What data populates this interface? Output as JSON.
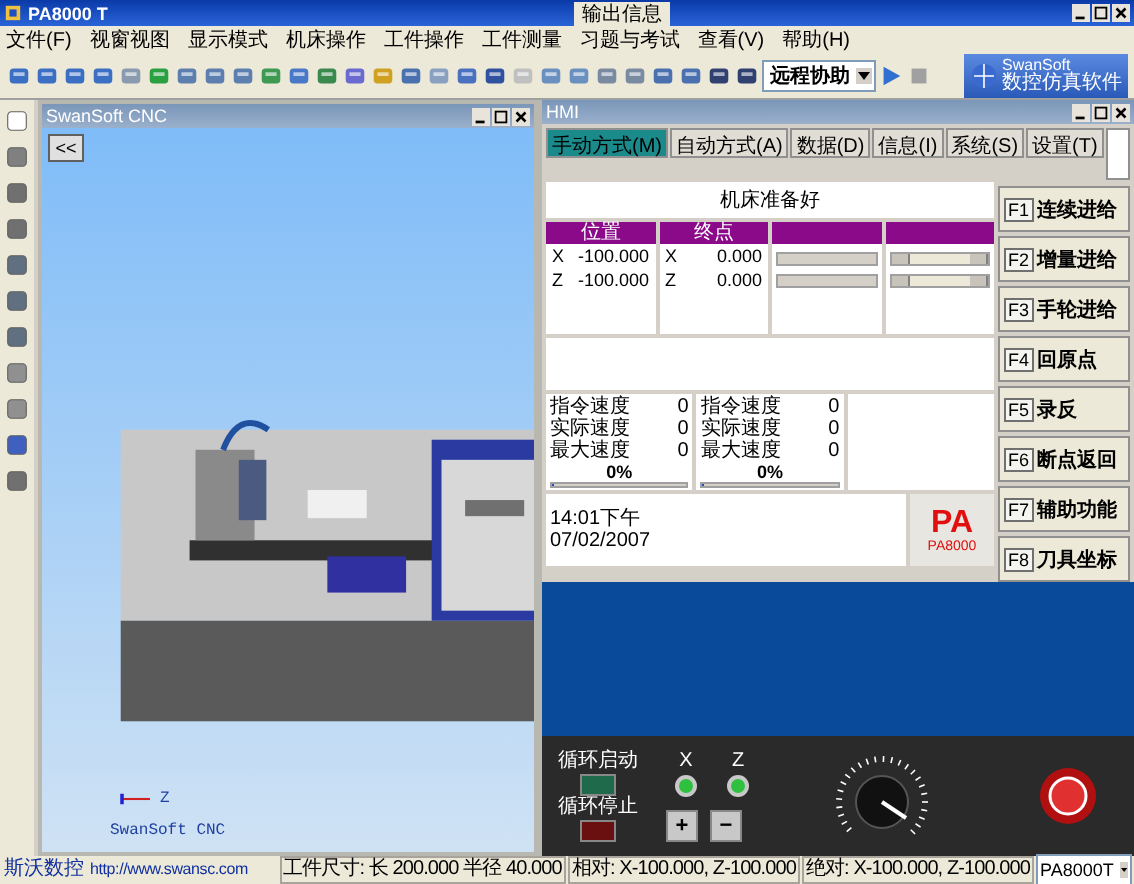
{
  "window": {
    "title": "PA8000 T",
    "output_tab": "输出信息"
  },
  "menu": [
    "文件(F)",
    "视窗视图",
    "显示模式",
    "机床操作",
    "工件操作",
    "工件测量",
    "习题与考试",
    "查看(V)",
    "帮助(H)"
  ],
  "toolbar": {
    "dropdown": "远程协助",
    "logo_line1": "SwanSoft",
    "logo_line2": "数控仿真软件"
  },
  "sim_window": {
    "title": "SwanSoft CNC",
    "collapse": "<<",
    "axis_label": "Z",
    "caption": "SwanSoft CNC"
  },
  "hmi": {
    "title": "HMI",
    "tabs": [
      {
        "label": "手动方式(M)",
        "selected": true
      },
      {
        "label": "自动方式(A)",
        "selected": false
      },
      {
        "label": "数据(D)",
        "selected": false
      },
      {
        "label": "信息(I)",
        "selected": false
      },
      {
        "label": "系统(S)",
        "selected": false
      },
      {
        "label": "设置(T)",
        "selected": false
      }
    ],
    "message": "机床准备好",
    "tables": [
      {
        "heading": "位置",
        "rows": [
          {
            "axis": "X",
            "value": "-100.000"
          },
          {
            "axis": "Z",
            "value": "-100.000"
          }
        ]
      },
      {
        "heading": "终点",
        "rows": [
          {
            "axis": "X",
            "value": "0.000"
          },
          {
            "axis": "Z",
            "value": "0.000"
          }
        ]
      }
    ],
    "speed_panels": [
      {
        "rows": [
          {
            "label": "指令速度",
            "value": "0"
          },
          {
            "label": "实际速度",
            "value": "0"
          },
          {
            "label": "最大速度",
            "value": "0"
          }
        ],
        "percent": "0%",
        "level": 0
      },
      {
        "rows": [
          {
            "label": "指令速度",
            "value": "0"
          },
          {
            "label": "实际速度",
            "value": "0"
          },
          {
            "label": "最大速度",
            "value": "0"
          }
        ],
        "percent": "0%",
        "level": 0
      }
    ],
    "time": "14:01下午",
    "date": "07/02/2007",
    "logo": "PA",
    "logo_model": "PA8000",
    "fkeys": [
      {
        "key": "F1",
        "label": "连续进给"
      },
      {
        "key": "F2",
        "label": "增量进给"
      },
      {
        "key": "F3",
        "label": "手轮进给"
      },
      {
        "key": "F4",
        "label": "回原点"
      },
      {
        "key": "F5",
        "label": "录反"
      },
      {
        "key": "F6",
        "label": "断点返回"
      },
      {
        "key": "F7",
        "label": "辅助功能"
      },
      {
        "key": "F8",
        "label": "刀具坐标"
      }
    ]
  },
  "panel": {
    "cycle_start": "循环启动",
    "cycle_stop": "循环停止",
    "lamps": [
      {
        "label": "X",
        "on": true
      },
      {
        "label": "Z",
        "on": true
      }
    ],
    "plus": "+",
    "minus": "−"
  },
  "status_bar": {
    "brand": "斯沃数控",
    "url": "http://www.swansc.com",
    "size": "工件尺寸: 长 200.000 半径 40.000",
    "relative": "相对: X-100.000, Z-100.000",
    "absolute": "绝对: X-100.000, Z-100.000",
    "machine": "PA8000T"
  }
}
